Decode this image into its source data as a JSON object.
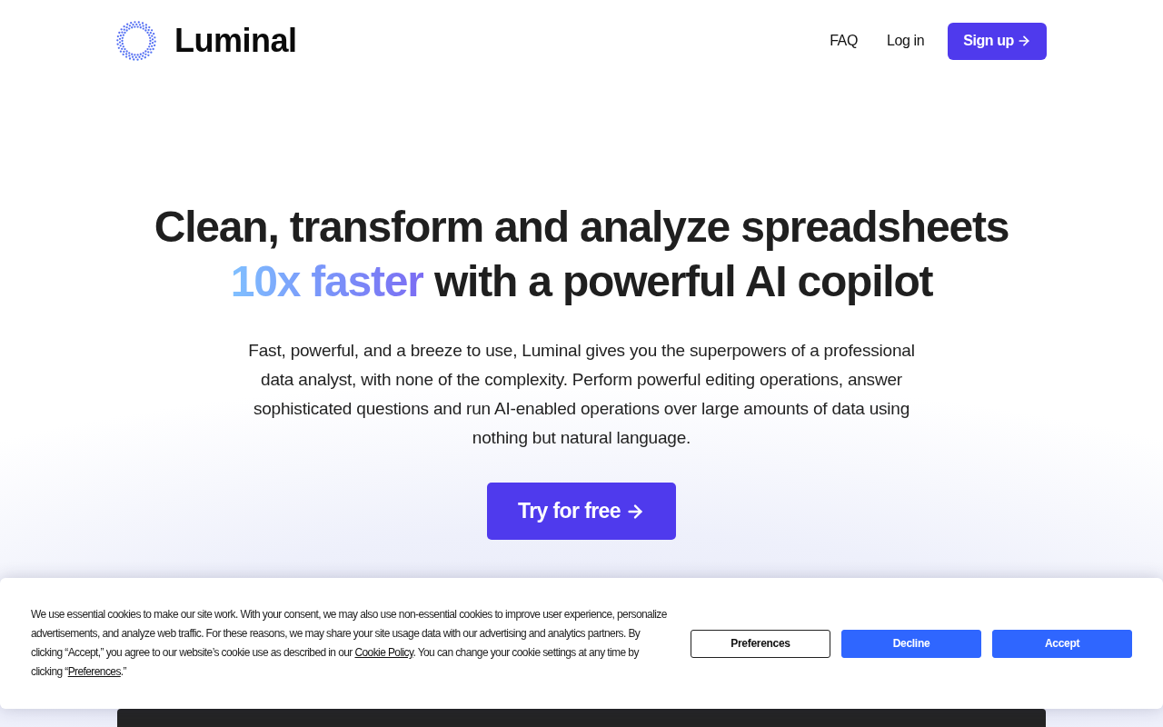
{
  "nav": {
    "brand": "Luminal",
    "links": [
      "FAQ",
      "Log in"
    ],
    "cta": "Sign up"
  },
  "hero": {
    "headline_start": "Clean, transform and analyze spreadsheets",
    "headline_highlight": "10x faster",
    "headline_end": "with a powerful AI copilot",
    "description": "Fast, powerful, and a breeze to use, Luminal gives you the superpowers of a professional data analyst, with none of the complexity. Perform powerful editing operations, answer sophisticated questions and run AI-enabled operations over large amounts of data using nothing but natural language.",
    "cta": "Try for free"
  },
  "cookie_banner": {
    "message": [
      {
        "kind": "text",
        "text": "We use essential cookies to make our site work. With your consent, we may also use non-essential cookies to improve user experience, personalize advertisements, and analyze web traffic. For these reasons, we may share your site usage data with our advertising and analytics partners. By clicking “Accept,” you agree to our website’s cookie use as described in our "
      },
      {
        "kind": "link",
        "text": "Cookie Policy"
      },
      {
        "kind": "text",
        "text": ". You can change your cookie settings at any time by clicking “"
      },
      {
        "kind": "link",
        "text": "Preferences"
      },
      {
        "kind": "text",
        "text": ".”"
      }
    ],
    "buttons": [
      {
        "label": "Preferences",
        "kind": "outline"
      },
      {
        "label": "Decline",
        "kind": "primary"
      },
      {
        "label": "Accept",
        "kind": "primary"
      }
    ]
  }
}
